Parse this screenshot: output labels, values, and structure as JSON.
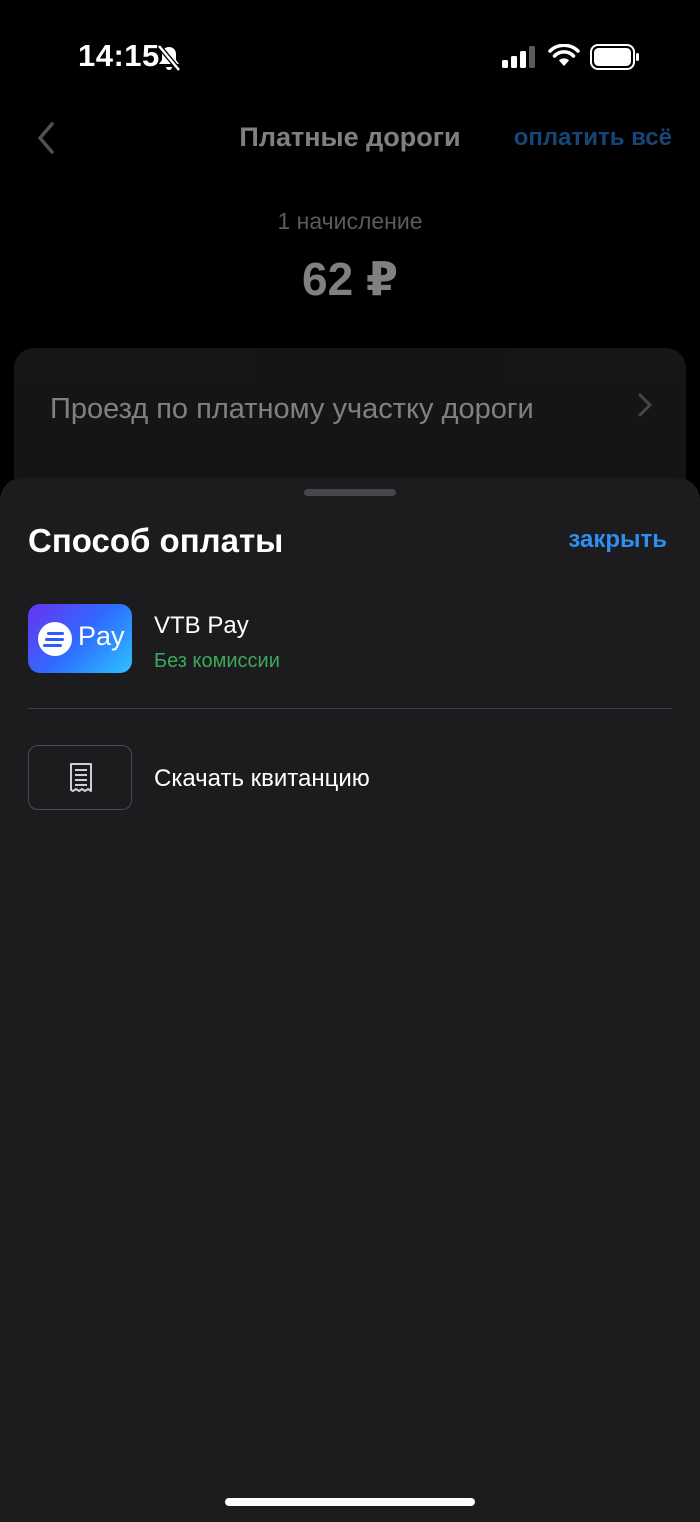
{
  "status_bar": {
    "time": "14:15",
    "icons": [
      "bell-off-icon",
      "cellular-signal-icon",
      "wifi-icon",
      "battery-icon"
    ]
  },
  "header": {
    "title": "Платные дороги",
    "pay_all_label": "оплатить всё",
    "back_icon": "chevron-left-icon"
  },
  "summary": {
    "charges_count": "1 начисление",
    "amount": "62 ₽"
  },
  "charge": {
    "title": "Проезд по платному участку дороги",
    "chevron_icon": "chevron-right-icon"
  },
  "sheet": {
    "title": "Способ оплаты",
    "close_label": "закрыть",
    "options": [
      {
        "name": "VTB Pay",
        "subtitle": "Без комиссии",
        "logo_text": "Pay",
        "logo_icon": "vtb-pay-logo"
      }
    ],
    "receipt": {
      "label": "Скачать квитанцию",
      "icon": "receipt-icon"
    }
  },
  "colors": {
    "background": "#000000",
    "sheet_background": "#1c1c1e",
    "accent_blue": "#2e8ef2",
    "success_green": "#3ca85a",
    "card_background": "#2b2b2f"
  }
}
